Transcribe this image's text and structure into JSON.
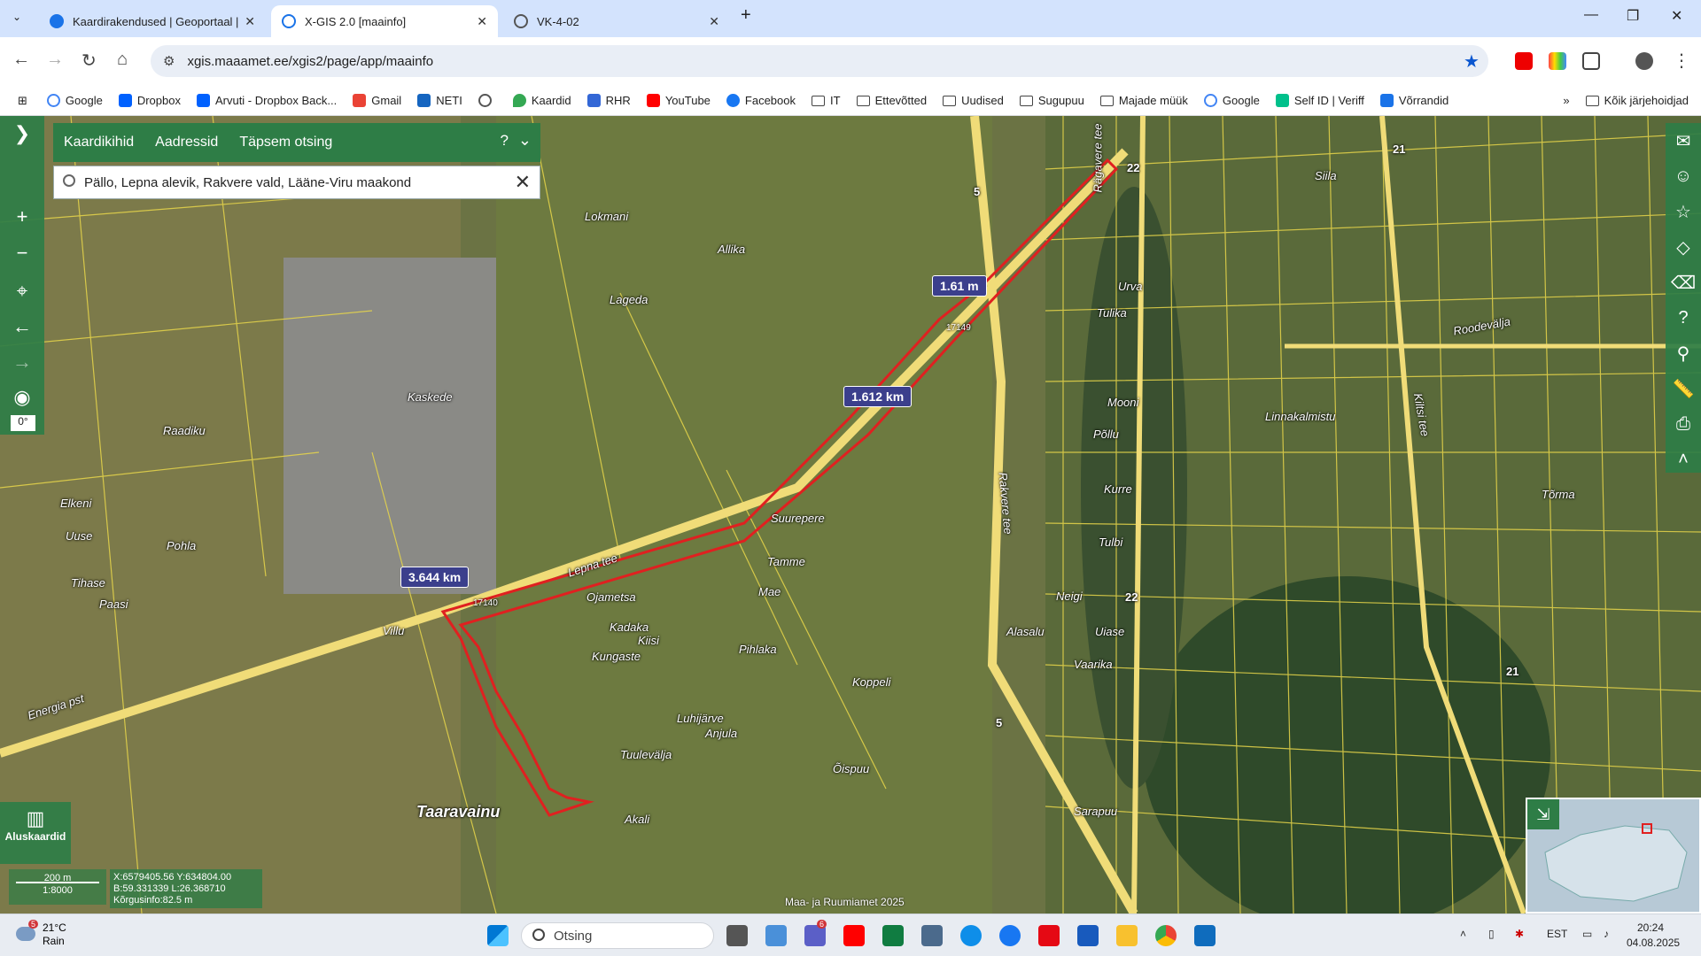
{
  "browser": {
    "tabs": [
      {
        "label": "Kaardirakendused | Geoportaal | M",
        "active": false
      },
      {
        "label": "X-GIS 2.0 [maainfo]",
        "active": true
      },
      {
        "label": "VK-4-02",
        "active": false
      }
    ],
    "url": "xgis.maaamet.ee/xgis2/page/app/maainfo",
    "bookmarks": [
      "Google",
      "Dropbox",
      "Arvuti - Dropbox Back...",
      "Gmail",
      "NETI",
      "Kaardid",
      "RHR",
      "YouTube",
      "Facebook",
      "IT",
      "Ettevõtted",
      "Uudised",
      "Sugupuu",
      "Majade müük",
      "Google",
      "Self ID | Veriff",
      "Võrrandid"
    ],
    "all_bookmarks": "Kõik järjehoidjad"
  },
  "panel": {
    "tabs": [
      "Kaardikihid",
      "Aadressid",
      "Täpsem otsing"
    ],
    "help": "?",
    "search_value": "Pällo, Lepna alevik, Rakvere vald, Lääne-Viru maakond"
  },
  "map": {
    "rotation": "0°",
    "measurements": [
      "1.61 m",
      "1.612 km",
      "3.644 km"
    ],
    "labels": [
      "Lokmani",
      "Allika",
      "Lageda",
      "Kaskede",
      "Raadiku",
      "Elkeni",
      "Uuse",
      "Pohla",
      "Tihase",
      "Paasi",
      "Villu",
      "Ojametsa",
      "Kadaka",
      "Kiisi",
      "Kungaste",
      "Suurepere",
      "Tamme",
      "Mae",
      "Pihlaka",
      "Koppeli",
      "Luhijärve",
      "Anjula",
      "Tuulevälja",
      "Õispuu",
      "Akali",
      "Alasalu",
      "Taaravainu",
      "Linnakalmistu",
      "Siila",
      "Urva",
      "Tulika",
      "Mooni",
      "Põllu",
      "Kurre",
      "Tulbi",
      "Neigi",
      "Uiase",
      "Vaarika",
      "Sarapuu",
      "Lepna tee",
      "Energia pst",
      "Rägavere tee",
      "Rakvere tee",
      "Kiltsi tee",
      "Roodevälja",
      "Tõrma"
    ],
    "road_numbers": [
      "5",
      "22",
      "21"
    ],
    "parcel_ids": [
      "17140",
      "17149"
    ],
    "basemaps_label": "Aluskaardid",
    "scale": {
      "distance": "200 m",
      "ratio": "1:8000"
    },
    "coords": {
      "xy": "X:6579405.56 Y:634804.00",
      "bl": "B:59.331339 L:26.368710",
      "height": "Kõrgusinfo:82.5 m"
    },
    "copyright": "Maa- ja Ruumiamet 2025"
  },
  "taskbar": {
    "weather_temp": "21°C",
    "weather_desc": "Rain",
    "weather_badge": "5",
    "search_placeholder": "Otsing",
    "lang": "EST",
    "time": "20:24",
    "date": "04.08.2025",
    "teams_badge": "6"
  },
  "colors": {
    "panel_green": "#2e7d46",
    "parcel_yellow": "#e8d64a",
    "selection_red": "#e02020",
    "chrome_accent": "#d3e3fd"
  }
}
